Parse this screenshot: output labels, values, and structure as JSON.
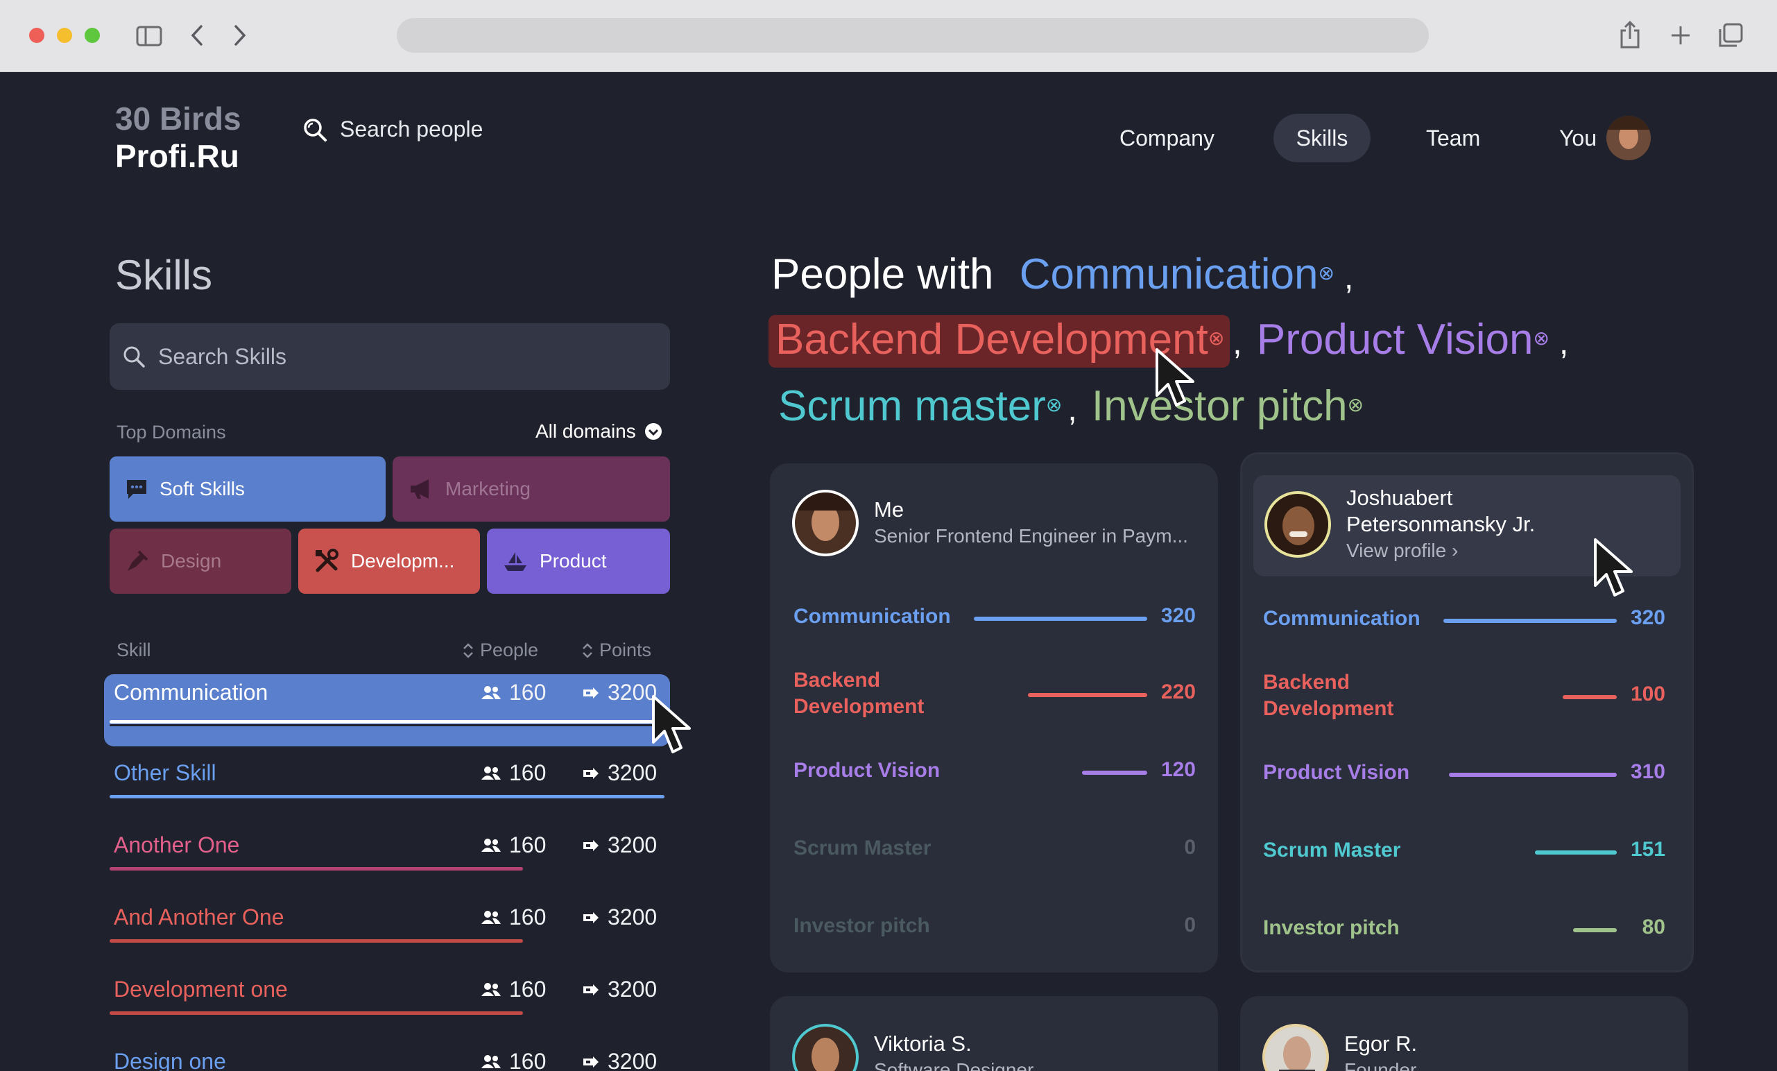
{
  "header": {
    "logo_line1": "30 Birds",
    "logo_line2": "Profi.Ru",
    "search_placeholder": "Search people",
    "nav": [
      "Company",
      "Skills",
      "Team",
      "You"
    ]
  },
  "left": {
    "title": "Skills",
    "search_placeholder": "Search Skills",
    "top_domains_label": "Top Domains",
    "all_domains_label": "All domains",
    "domains": [
      {
        "label": "Soft Skills",
        "icon": "chat-icon",
        "color": "#5a7fcc"
      },
      {
        "label": "Marketing",
        "icon": "megaphone-icon",
        "color": "#6a3258"
      },
      {
        "label": "Design",
        "icon": "pen-icon",
        "color": "#6e2f47"
      },
      {
        "label": "Developm...",
        "icon": "tools-icon",
        "color": "#c9524f"
      },
      {
        "label": "Product",
        "icon": "boat-icon",
        "color": "#7760d3"
      }
    ],
    "columns": {
      "skill": "Skill",
      "people": "People",
      "points": "Points"
    },
    "skills": [
      {
        "name": "Communication",
        "people": "160",
        "points": "3200",
        "color": "#ffffff"
      },
      {
        "name": "Other Skill",
        "people": "160",
        "points": "3200",
        "color": "#6b9ff0"
      },
      {
        "name": "Another One",
        "people": "160",
        "points": "3200",
        "color": "#e2608b"
      },
      {
        "name": "And Another One",
        "people": "160",
        "points": "3200",
        "color": "#e8615d"
      },
      {
        "name": "Development one",
        "people": "160",
        "points": "3200",
        "color": "#e8615d"
      },
      {
        "name": "Design one",
        "people": "160",
        "points": "3200",
        "color": "#6b9ff0"
      }
    ]
  },
  "heading": {
    "prefix": "People with",
    "tags": [
      {
        "label": "Communication",
        "color": "#6b9ff0"
      },
      {
        "label": "Backend Development",
        "color": "#e8615d"
      },
      {
        "label": "Product Vision",
        "color": "#a77de8"
      },
      {
        "label": "Scrum master",
        "color": "#4fc9cf"
      },
      {
        "label": "Investor pitch",
        "color": "#9fc38a"
      }
    ],
    "separator": ","
  },
  "cards": [
    {
      "name": "Me",
      "role": "Senior Frontend Engineer in Paym...",
      "skills": [
        {
          "label": "Communication",
          "value": "320",
          "level": 320
        },
        {
          "label": "Backend Development",
          "value": "220",
          "level": 220
        },
        {
          "label": "Product Vision",
          "value": "120",
          "level": 120
        },
        {
          "label": "Scrum Master",
          "value": "0",
          "level": 0
        },
        {
          "label": "Investor pitch",
          "value": "0",
          "level": 0
        }
      ]
    },
    {
      "name": "Joshuabert Petersonmansky Jr.",
      "name_line1": "Joshuabert",
      "name_line2": "Petersonmansky Jr.",
      "link": "View profile",
      "skills": [
        {
          "label": "Communication",
          "value": "320",
          "level": 320
        },
        {
          "label": "Backend Development",
          "value": "100",
          "level": 100
        },
        {
          "label": "Product Vision",
          "value": "310",
          "level": 310
        },
        {
          "label": "Scrum Master",
          "value": "151",
          "level": 151
        },
        {
          "label": "Investor pitch",
          "value": "80",
          "level": 80
        }
      ]
    },
    {
      "name": "Viktoria S.",
      "role": "Software Designer"
    },
    {
      "name": "Egor R.",
      "role": "Founder"
    }
  ],
  "skill_colors": [
    "#6b9ff0",
    "#e8615d",
    "#a77de8",
    "#4fc9cf",
    "#9fc38a"
  ]
}
